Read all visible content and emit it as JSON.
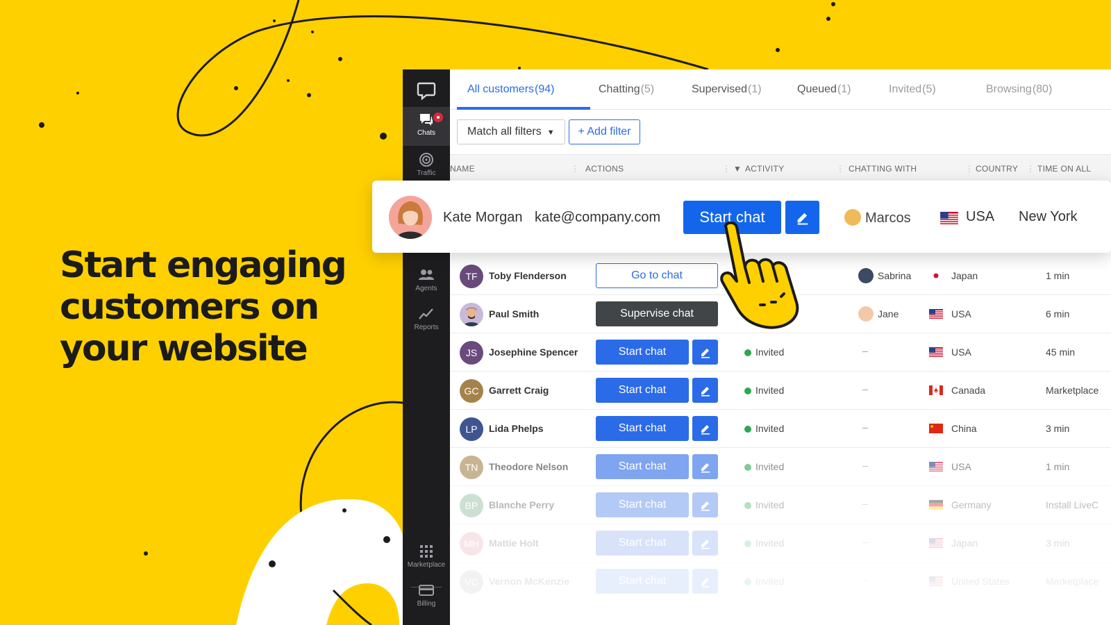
{
  "headline": [
    "Start engaging",
    "customers on",
    "your website"
  ],
  "colors": {
    "background": "#ffd000",
    "accent": "#2b6be8",
    "sidebar": "#1d1d1f",
    "invited": "#2ea84f"
  },
  "sidebar": {
    "items": [
      {
        "label": "Chats",
        "icon": "chat-icon",
        "active": true,
        "badge": true
      },
      {
        "label": "Traffic",
        "icon": "radar-icon"
      },
      {
        "label": "Agents",
        "icon": "agents-icon"
      },
      {
        "label": "Reports",
        "icon": "chart-line-icon"
      },
      {
        "label": "Marketplace",
        "icon": "grid-icon"
      },
      {
        "label": "Billing",
        "icon": "credit-card-icon"
      }
    ]
  },
  "tabs": [
    {
      "label": "All customers",
      "count": "(94)",
      "active": true
    },
    {
      "label": "Chatting",
      "count": "(5)"
    },
    {
      "label": "Supervised",
      "count": "(1)"
    },
    {
      "label": "Queued",
      "count": "(1)"
    },
    {
      "label": "Invited",
      "count": "(5)"
    },
    {
      "label": "Browsing",
      "count": "(80)"
    }
  ],
  "filters": {
    "match_label": "Match all filters",
    "add_label": "+ Add filter"
  },
  "columns": [
    "NAME",
    "ACTIONS",
    "ACTIVITY",
    "CHATTING WITH",
    "COUNTRY",
    "TIME ON ALL"
  ],
  "highlight": {
    "name": "Kate Morgan",
    "email": "kate@company.com",
    "action": "Start chat",
    "agent": "Marcos",
    "country": "USA",
    "city": "New York"
  },
  "rows": [
    {
      "initials": "TF",
      "name": "Toby Flenderson",
      "action": "Go to chat",
      "action_type": "goto",
      "activity": "",
      "agent": "Sabrina",
      "country": "Japan",
      "time": "1 min"
    },
    {
      "initials": "PS",
      "name": "Paul Smith",
      "action": "Supervise chat",
      "action_type": "supervise",
      "activity": "",
      "agent": "Jane",
      "country": "USA",
      "time": "6 min"
    },
    {
      "initials": "JS",
      "name": "Josephine Spencer",
      "action": "Start chat",
      "action_type": "start",
      "activity": "Invited",
      "agent": "–",
      "country": "USA",
      "time": "45 min"
    },
    {
      "initials": "GC",
      "name": "Garrett Craig",
      "action": "Start chat",
      "action_type": "start",
      "activity": "Invited",
      "agent": "–",
      "country": "Canada",
      "time": "Marketplace"
    },
    {
      "initials": "LP",
      "name": "Lida Phelps",
      "action": "Start chat",
      "action_type": "start",
      "activity": "Invited",
      "agent": "–",
      "country": "China",
      "time": "3 min"
    },
    {
      "initials": "TN",
      "name": "Theodore Nelson",
      "action": "Start chat",
      "action_type": "start",
      "activity": "Invited",
      "agent": "–",
      "country": "USA",
      "time": "1 min"
    },
    {
      "initials": "BP",
      "name": "Blanche Perry",
      "action": "Start chat",
      "action_type": "start",
      "activity": "Invited",
      "agent": "–",
      "country": "Germany",
      "time": "Install LiveC"
    },
    {
      "initials": "MH",
      "name": "Mattie Holt",
      "action": "Start chat",
      "action_type": "start",
      "activity": "Invited",
      "agent": "–",
      "country": "Japan",
      "time": "3 min"
    },
    {
      "initials": "VC",
      "name": "Vernon McKenzie",
      "action": "Start chat",
      "action_type": "start",
      "activity": "Invited",
      "agent": "–",
      "country": "United States",
      "time": "Marketplace"
    }
  ]
}
